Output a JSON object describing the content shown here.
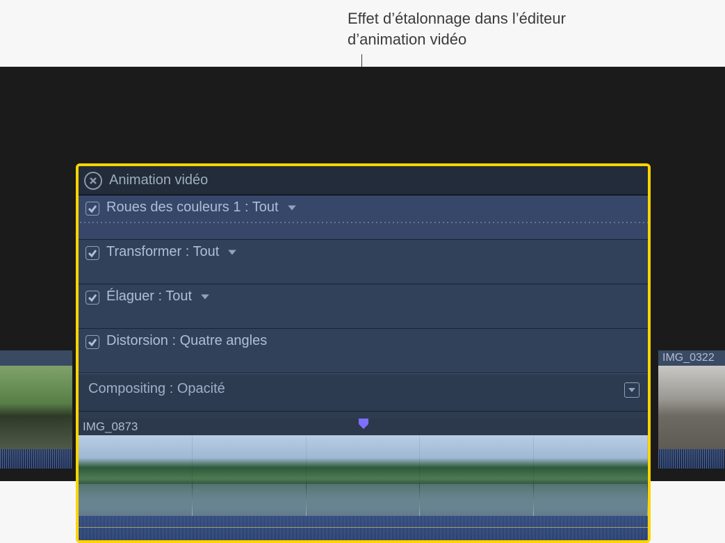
{
  "callout": {
    "line1": "Effet d’étalonnage dans l’éditeur",
    "line2": "d’animation vidéo"
  },
  "editor": {
    "header_title": "Animation vidéo",
    "rows": [
      {
        "label": "Roues des couleurs 1 : Tout",
        "checked": true,
        "has_dropdown": true
      },
      {
        "label": "Transformer : Tout",
        "checked": true,
        "has_dropdown": true
      },
      {
        "label": "Élaguer : Tout",
        "checked": true,
        "has_dropdown": true
      },
      {
        "label": "Distorsion : Quatre angles",
        "checked": true,
        "has_dropdown": false
      }
    ],
    "compositing_label": "Compositing : Opacité",
    "clip_name": "IMG_0873"
  },
  "neighbor_clips": {
    "right_label": "IMG_0322"
  }
}
